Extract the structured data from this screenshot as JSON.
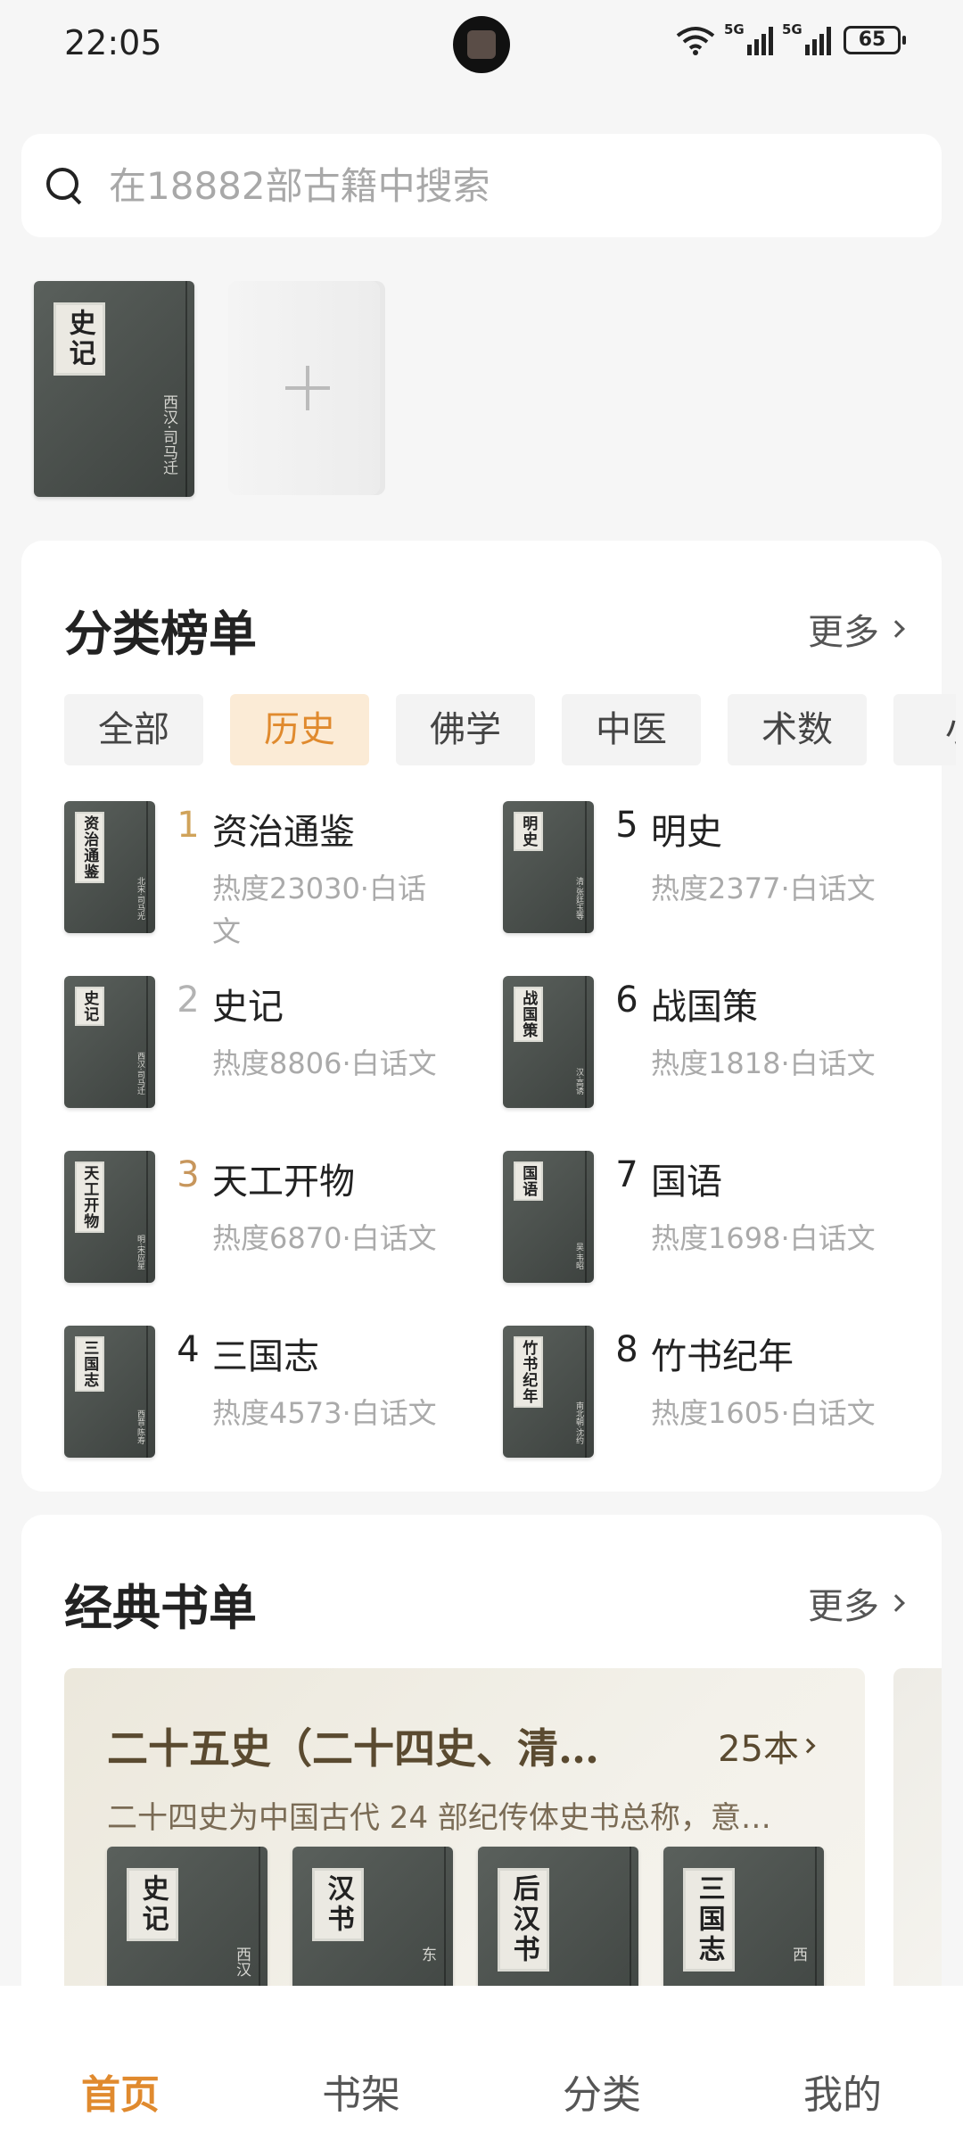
{
  "status_bar": {
    "time": "22:05",
    "battery": "65",
    "signal1_label": "5G",
    "signal2_label": "5G"
  },
  "search": {
    "placeholder": "在18882部古籍中搜索"
  },
  "recent_books": [
    {
      "title": "史记",
      "author": "西汉·司马迁"
    }
  ],
  "ranking": {
    "title": "分类榜单",
    "more": "更多",
    "tabs": [
      "全部",
      "历史",
      "佛学",
      "中医",
      "术数",
      "小"
    ],
    "active_tab": "历史",
    "items": [
      {
        "rank": "1",
        "name": "资治通鉴",
        "meta": "热度23030·白话文",
        "author": "北宋·司马光"
      },
      {
        "rank": "5",
        "name": "明史",
        "meta": "热度2377·白话文",
        "author": "清·张廷玉等"
      },
      {
        "rank": "2",
        "name": "史记",
        "meta": "热度8806·白话文",
        "author": "西汉·司马迁"
      },
      {
        "rank": "6",
        "name": "战国策",
        "meta": "热度1818·白话文",
        "author": "汉·高诱"
      },
      {
        "rank": "3",
        "name": "天工开物",
        "meta": "热度6870·白话文",
        "author": "明·宋应星"
      },
      {
        "rank": "7",
        "name": "国语",
        "meta": "热度1698·白话文",
        "author": "吴·韦昭"
      },
      {
        "rank": "4",
        "name": "三国志",
        "meta": "热度4573·白话文",
        "author": "西晋·陈寿"
      },
      {
        "rank": "8",
        "name": "竹书纪年",
        "meta": "热度1605·白话文",
        "author": "南北朝·沈约"
      }
    ]
  },
  "classic_lists": {
    "title": "经典书单",
    "more": "更多",
    "featured": {
      "name": "二十五史（二十四史、清…",
      "count": "25本",
      "desc": "二十四史为中国古代 24 部纪传体史书总称，意…",
      "books": [
        {
          "title": "史记",
          "author": "西汉"
        },
        {
          "title": "汉书",
          "author": "东"
        },
        {
          "title": "后汉书",
          "author": ""
        },
        {
          "title": "三国志",
          "author": "西"
        }
      ]
    }
  },
  "bottom_nav": {
    "items": [
      "首页",
      "书架",
      "分类",
      "我的"
    ],
    "active": "首页"
  },
  "colors": {
    "accent": "#e08a2e",
    "tab_active_bg": "#fbebd6",
    "cover": "#4a4f4c"
  }
}
